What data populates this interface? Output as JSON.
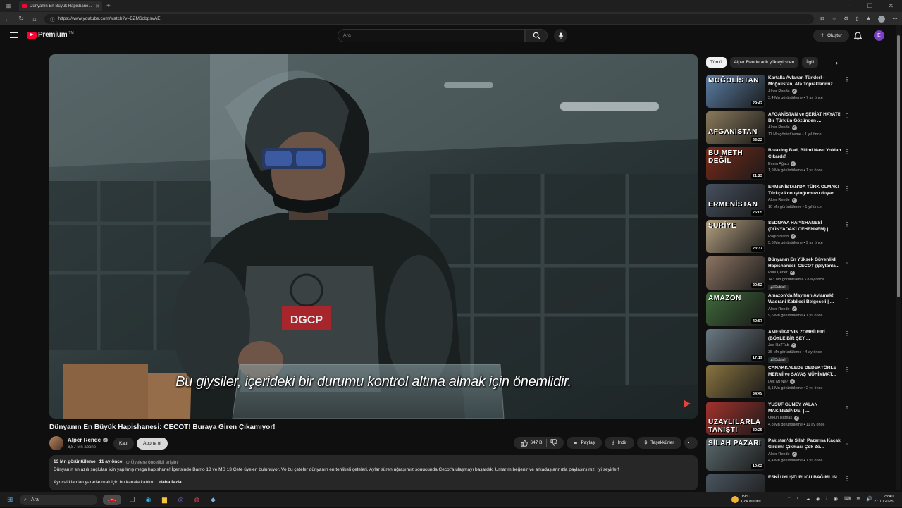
{
  "browser": {
    "tab_title": "Dünyanın En Büyük Hapishane...",
    "url": "https://www.youtube.com/watch?v=BZM6obpsvAE"
  },
  "header": {
    "logo_text": "Premium",
    "logo_tm": "TM",
    "search_placeholder": "Ara",
    "create_label": "Oluştur",
    "avatar_letter": "E"
  },
  "player": {
    "subtitle": "Bu giysiler, içerideki bir durumu kontrol altına almak için önemlidir."
  },
  "video": {
    "title": "Dünyanın En Büyük Hapishanesi: CECOT! Buraya Giren Çıkamıyor!",
    "channel": "Alper Rende",
    "subscribers": "6,87 Mn abone",
    "join_label": "Katıl",
    "subscribe_label": "Abone ol",
    "likes": "647 B",
    "share_label": "Paylaş",
    "download_label": "İndir",
    "thanks_label": "Teşekkürler"
  },
  "description": {
    "views": "13 Mn görüntüleme",
    "date": "11 ay önce",
    "members": "Üyelere öncelikli erişim",
    "text1": "Dünyanın en azılı suçluları için yapılmış mega hapishane! İçerisinde Barrio 18 ve MS 13 Çete üyeleri bulunuyor. Ve bu çeteler dünyanın en tehlikeli çeteleri. Aylar süren uğraşımız sonucunda Cecot'a ulaşmayı başardık. Umarım beğenir ve arkadaşlarınızla paylaşırsınız. İyi seyirler!",
    "text2": "Ayrıcalıklardan yararlanmak için bu kanala katılın:",
    "more": "...daha fazla"
  },
  "chips": [
    "Tümü",
    "Alper Rende adlı yükleyiciden",
    "İlgili"
  ],
  "recommendations": [
    {
      "title": "Kartalla Avlanan Türkler! - Moğolistan, Ata Topraklarımız",
      "channel": "Alper Rende",
      "stats": "3,4 Mn görüntüleme • 7 ay önce",
      "duration": "29:42",
      "label": "MOĞOLİSTAN",
      "color": "#5b7fa6",
      "dubbed": ""
    },
    {
      "title": "AFGANİSTAN ve ŞERİAT HAYATI! Bir Türk'ün Gözünden ...",
      "channel": "Alper Rende",
      "stats": "11 Mn görüntüleme • 1 yıl önce",
      "duration": "23:22",
      "label": "AFGANİSTAN",
      "color": "#8a7a5c",
      "dubbed": ""
    },
    {
      "title": "Breaking Bad, Bilimi Nasıl Yoldan Çıkardı?",
      "channel": "Emim Ağacı",
      "stats": "1,9 Mn görüntüleme • 1 yıl önce",
      "duration": "21:23",
      "label": "BU METH DEĞİL",
      "color": "#7a2a18",
      "dubbed": ""
    },
    {
      "title": "ERMENİSTAN'DA TÜRK OLMAK! Türkçe konuştuğumuzu duyan ...",
      "channel": "Alper Rende",
      "stats": "10 Mn görüntüleme • 1 yıl önce",
      "duration": "25:05",
      "label": "ERMENİSTAN",
      "color": "#46505e",
      "dubbed": ""
    },
    {
      "title": "SEDNAYA HAPİSHANESİ (DÜNYADAKİ CEHENNEM) | ...",
      "channel": "Ragıb Narin",
      "stats": "5,6 Mn görüntüleme • 9 ay önce",
      "duration": "23:37",
      "label": "SURİYE",
      "color": "#b4a080",
      "dubbed": ""
    },
    {
      "title": "Dünyanın En Yüksek Güvenlikli Hapishanesi: CECOT (Şeytanla...",
      "channel": "Ruhi Çenet",
      "stats": "143 Mn görüntüleme • 8 ay önce",
      "duration": "20:52",
      "label": "",
      "color": "#8c7462",
      "dubbed": "Dublajlı"
    },
    {
      "title": "Amazon'da Maymun Avlamak! Waorani Kabilesi Belgeseli | ...",
      "channel": "Alper Rende",
      "stats": "9,6 Mn görüntüleme • 1 yıl önce",
      "duration": "40:57",
      "label": "AMAZON",
      "color": "#3f6a3a",
      "dubbed": ""
    },
    {
      "title": "AMERİKA'NIN ZOMBİLERİ (BÖYLE BİR ŞEY ...",
      "channel": "Joe HaTTab",
      "stats": "35 Mn görüntüleme • 4 ay önce",
      "duration": "17:19",
      "label": "",
      "color": "#6b7a84",
      "dubbed": "Dublajlı"
    },
    {
      "title": "ÇANAKKALEDE DEDEKTÖRLE MERMİ ve SAVAŞ MÜHİMMAT...",
      "channel": "Deli Mi Ne?",
      "stats": "8,1 Mn görüntüleme • 2 yıl önce",
      "duration": "34:49",
      "label": "",
      "color": "#8a7540",
      "dubbed": ""
    },
    {
      "title": "YUSUF GÜNEY YALAN MAKİNESİNDE! | ...",
      "channel": "Orkun Işıtmak",
      "stats": "4,8 Mn görüntüleme • 11 ay önce",
      "duration": "30:25",
      "label": "UZAYLILARLA TANIŞTI",
      "color": "#a4322c",
      "dubbed": ""
    },
    {
      "title": "Pakistan'da Silah Pazarına Kaçak Girdim! Çıkması Çok Zo...",
      "channel": "Alper Rende",
      "stats": "4,4 Mn görüntüleme • 1 yıl önce",
      "duration": "19:02",
      "label": "SİLAH PAZARI",
      "color": "#5c6a6e",
      "dubbed": ""
    },
    {
      "title": "ESKİ UYUŞTURUCU BAĞIMLISI",
      "channel": "",
      "stats": "",
      "duration": "",
      "label": "",
      "color": "#4a5560",
      "dubbed": ""
    }
  ],
  "taskbar": {
    "search_label": "Ara",
    "weather_temp": "19°C",
    "weather_desc": "Çok bulutlu",
    "time": "23:40",
    "date": "27.10.2025"
  },
  "colors": {
    "background": "#0f0f0f",
    "brand_red": "#ff0033",
    "surface": "#272727"
  }
}
